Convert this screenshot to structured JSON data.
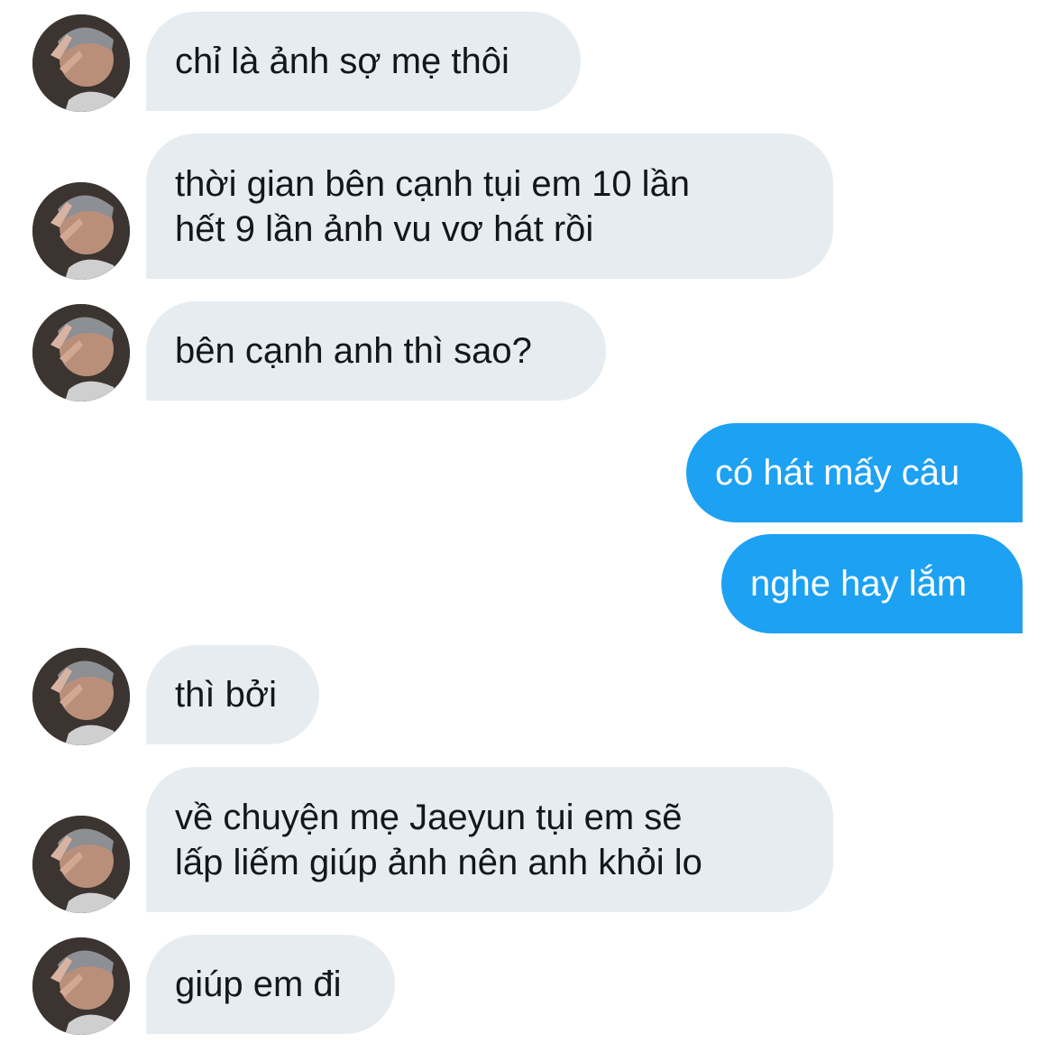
{
  "conversation": {
    "messages": [
      {
        "side": "in",
        "lines": [
          "chỉ là ảnh sợ mẹ thôi"
        ]
      },
      {
        "side": "in",
        "lines": [
          "thời gian bên cạnh tụi em 10 lần",
          "hết 9 lần ảnh vu vơ hát rồi"
        ]
      },
      {
        "side": "in",
        "lines": [
          "bên cạnh anh thì sao?"
        ]
      },
      {
        "side": "out",
        "lines": [
          "có hát mấy câu"
        ]
      },
      {
        "side": "out",
        "lines": [
          "nghe hay lắm"
        ]
      },
      {
        "side": "in",
        "lines": [
          "thì bởi"
        ]
      },
      {
        "side": "in",
        "lines": [
          "về chuyện mẹ Jaeyun tụi em sẽ",
          "lấp liếm giúp ảnh nên anh khỏi lo"
        ]
      },
      {
        "side": "in",
        "lines": [
          "giúp em đi"
        ]
      }
    ]
  },
  "colors": {
    "incoming_bubble": "#e6ecf0",
    "incoming_text": "#14171a",
    "outgoing_bubble": "#1da1f2",
    "outgoing_text": "#ffffff"
  },
  "icons": {
    "avatar": "user-avatar-photo"
  }
}
